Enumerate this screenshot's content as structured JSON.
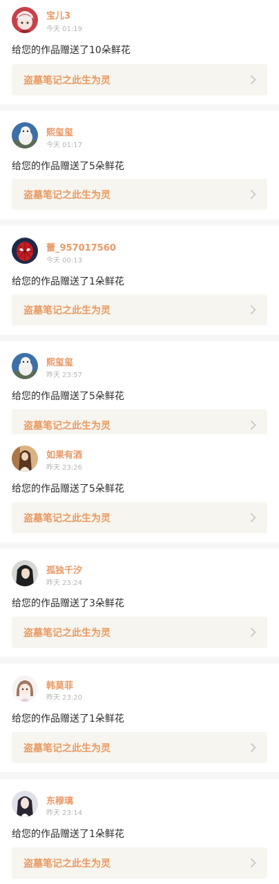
{
  "notifications": [
    {
      "user": "宝儿3",
      "time": "今天 01:19",
      "message": "给您的作品赠送了10朵鲜花",
      "work_title": "盗墓笔记之此生为灵",
      "avatar_icon": "anime-girl-red-avatar"
    },
    {
      "user": "熙玺玺",
      "time": "今天 01:17",
      "message": "给您的作品赠送了5朵鲜花",
      "work_title": "盗墓笔记之此生为灵",
      "avatar_icon": "white-dog-avatar"
    },
    {
      "user": "蕾_957017560",
      "time": "今天 00:13",
      "message": "给您的作品赠送了1朵鲜花",
      "work_title": "盗墓笔记之此生为灵",
      "avatar_icon": "spiderman-avatar"
    },
    {
      "user": "熙玺玺",
      "time": "昨天 23:57",
      "message": "给您的作品赠送了5朵鲜花",
      "work_title": "盗墓笔记之此生为灵",
      "avatar_icon": "white-dog-avatar"
    },
    {
      "user": "如果有酒",
      "time": "昨天 23:26",
      "message": "给您的作品赠送了5朵鲜花",
      "work_title": "盗墓笔记之此生为灵",
      "avatar_icon": "girl-photo-avatar"
    },
    {
      "user": "孤独千汐",
      "time": "昨天 23:24",
      "message": "给您的作品赠送了3朵鲜花",
      "work_title": "盗墓笔记之此生为灵",
      "avatar_icon": "girl-dark-hair-avatar"
    },
    {
      "user": "韩莫菲",
      "time": "昨天 23:20",
      "message": "给您的作品赠送了1朵鲜花",
      "work_title": "盗墓笔记之此生为灵",
      "avatar_icon": "cartoon-girl-avatar"
    },
    {
      "user": "东穆璃",
      "time": "昨天 23:14",
      "message": "给您的作品赠送了1朵鲜花",
      "work_title": "盗墓笔记之此生为灵",
      "avatar_icon": "girl-portrait-avatar"
    }
  ],
  "colors": {
    "username": "#e99966",
    "work_title": "#ea9a62",
    "time": "#b4b4b4",
    "work_bg": "#f6f5ef",
    "divider": "#f6f6f6"
  }
}
